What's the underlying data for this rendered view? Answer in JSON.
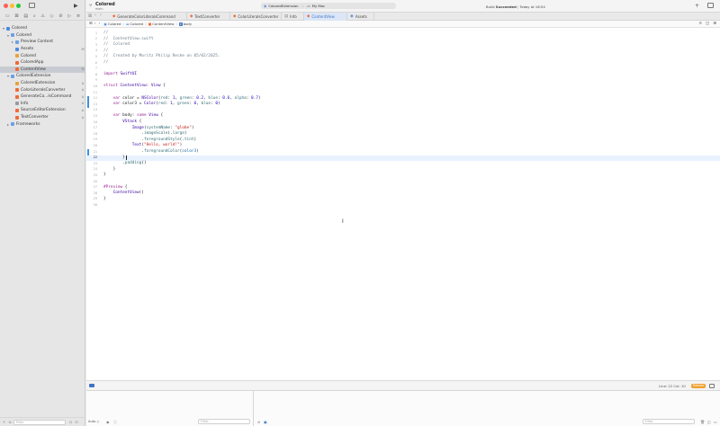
{
  "window": {
    "colors": {
      "close": "#fe5f57",
      "minimize": "#febc2e",
      "zoom": "#28c840",
      "accent": "#3f73c6",
      "warning": "#f0a030"
    }
  },
  "toolbar": {
    "project_name": "Colored",
    "project_sub": "main",
    "run_icon": "play-icon",
    "scheme_target": "ColoredExtension",
    "scheme_device": "My Mac",
    "build_status_prefix": "Build",
    "build_status_result": "Succeeded",
    "build_status_time": "Today at 18:54"
  },
  "sidebar": {
    "items": [
      {
        "label": "Colored",
        "indent": 0,
        "chevron": "▾",
        "color": "#4a8be0",
        "badge": "",
        "selected": false
      },
      {
        "label": "Colored",
        "indent": 1,
        "chevron": "▾",
        "color": "#6aa0e6",
        "badge": "",
        "selected": false
      },
      {
        "label": "Preview Content",
        "indent": 2,
        "chevron": "▸",
        "color": "#6aa0e6",
        "badge": "",
        "selected": false
      },
      {
        "label": "Assets",
        "indent": 2,
        "chevron": "",
        "color": "#4a8be0",
        "badge": "M",
        "selected": false
      },
      {
        "label": "Colored",
        "indent": 2,
        "chevron": "",
        "color": "#e8a33a",
        "badge": "",
        "selected": false
      },
      {
        "label": "ColoredApp",
        "indent": 2,
        "chevron": "",
        "color": "#f06a35",
        "badge": "",
        "selected": false
      },
      {
        "label": "ContentView",
        "indent": 2,
        "chevron": "",
        "color": "#f06a35",
        "badge": "M",
        "selected": true
      },
      {
        "label": "ColoredExtension",
        "indent": 1,
        "chevron": "▾",
        "color": "#6aa0e6",
        "badge": "",
        "selected": false
      },
      {
        "label": "ColoredExtension",
        "indent": 2,
        "chevron": "",
        "color": "#e8a33a",
        "badge": "A",
        "selected": false
      },
      {
        "label": "ColorLiteralsConverter",
        "indent": 2,
        "chevron": "",
        "color": "#f06a35",
        "badge": "A",
        "selected": false
      },
      {
        "label": "GenerateCo...lsCommand",
        "indent": 2,
        "chevron": "",
        "color": "#f06a35",
        "badge": "A",
        "selected": false
      },
      {
        "label": "Info",
        "indent": 2,
        "chevron": "",
        "color": "#9a9a9a",
        "badge": "A",
        "selected": false
      },
      {
        "label": "SourceEditorExtension",
        "indent": 2,
        "chevron": "",
        "color": "#f06a35",
        "badge": "A",
        "selected": false
      },
      {
        "label": "TextConverter",
        "indent": 2,
        "chevron": "",
        "color": "#f06a35",
        "badge": "A",
        "selected": false
      },
      {
        "label": "Frameworks",
        "indent": 1,
        "chevron": "▸",
        "color": "#6aa0e6",
        "badge": "",
        "selected": false
      }
    ],
    "filter_placeholder": "Filter"
  },
  "tabs": [
    {
      "label": "GenerateColorLiteralsCommand",
      "icon": "swift-icon",
      "active": false
    },
    {
      "label": "TextConverter",
      "icon": "swift-icon",
      "active": false
    },
    {
      "label": "ColorLiteralsConverter",
      "icon": "swift-icon",
      "active": false
    },
    {
      "label": "Info",
      "icon": "plist-icon",
      "active": false
    },
    {
      "label": "ContentView",
      "icon": "swift-icon",
      "active": true
    },
    {
      "label": "Assets",
      "icon": "assets-icon",
      "active": false
    }
  ],
  "breadcrumb": [
    "Colored",
    "Colored",
    "ContentView",
    "body"
  ],
  "editor": {
    "current_line": 22,
    "lines": [
      {
        "n": 1,
        "t": "//",
        "c": "cm"
      },
      {
        "n": 2,
        "t": "//  ContentView.swift",
        "c": "cm"
      },
      {
        "n": 3,
        "t": "//  Colored",
        "c": "cm"
      },
      {
        "n": 4,
        "t": "//",
        "c": "cm"
      },
      {
        "n": 5,
        "t": "//  Created by Moritz Philip Recke on 05/02/2025.",
        "c": "cm"
      },
      {
        "n": 6,
        "t": "//",
        "c": "cm"
      },
      {
        "n": 7,
        "t": "",
        "c": ""
      },
      {
        "n": 8,
        "t": "import SwiftUI",
        "c": "import"
      },
      {
        "n": 9,
        "t": "",
        "c": ""
      },
      {
        "n": 10,
        "t": "struct ContentView: View {",
        "c": "struct"
      },
      {
        "n": 11,
        "t": "",
        "c": ""
      },
      {
        "n": 12,
        "t": "    var color = NSColor(red: 1, green: 0.2, blue: 0.6, alpha: 0.7)",
        "c": "var"
      },
      {
        "n": 13,
        "t": "    var color3 = Color(red: 1, green: 0, blue: 0)",
        "c": "var"
      },
      {
        "n": 14,
        "t": "",
        "c": ""
      },
      {
        "n": 15,
        "t": "    var body: some View {",
        "c": "body"
      },
      {
        "n": 16,
        "t": "        VStack {",
        "c": "ty"
      },
      {
        "n": 17,
        "t": "            Image(systemName: \"globe\")",
        "c": "img"
      },
      {
        "n": 18,
        "t": "                .imageScale(.large)",
        "c": "fn"
      },
      {
        "n": 19,
        "t": "                .foregroundStyle(.tint)",
        "c": "fn"
      },
      {
        "n": 20,
        "t": "            Text(\"Hello, world!\")",
        "c": "txt"
      },
      {
        "n": 21,
        "t": "                .foregroundColor(color3)",
        "c": "fn"
      },
      {
        "n": 22,
        "t": "        }",
        "c": ""
      },
      {
        "n": 23,
        "t": "        .padding()",
        "c": "fn"
      },
      {
        "n": 24,
        "t": "    }",
        "c": ""
      },
      {
        "n": 25,
        "t": "}",
        "c": ""
      },
      {
        "n": 26,
        "t": "",
        "c": ""
      },
      {
        "n": 27,
        "t": "#Preview {",
        "c": "kw"
      },
      {
        "n": 28,
        "t": "    ContentView()",
        "c": "ty"
      },
      {
        "n": 29,
        "t": "}",
        "c": ""
      },
      {
        "n": 30,
        "t": "",
        "c": ""
      }
    ]
  },
  "statusbar": {
    "position": "Line: 22  Col: 10",
    "badge": "Rebase"
  },
  "debug": {
    "auto_label": "Auto ◇",
    "filter_placeholder": "Filter",
    "filter_placeholder_right": "Filter"
  }
}
